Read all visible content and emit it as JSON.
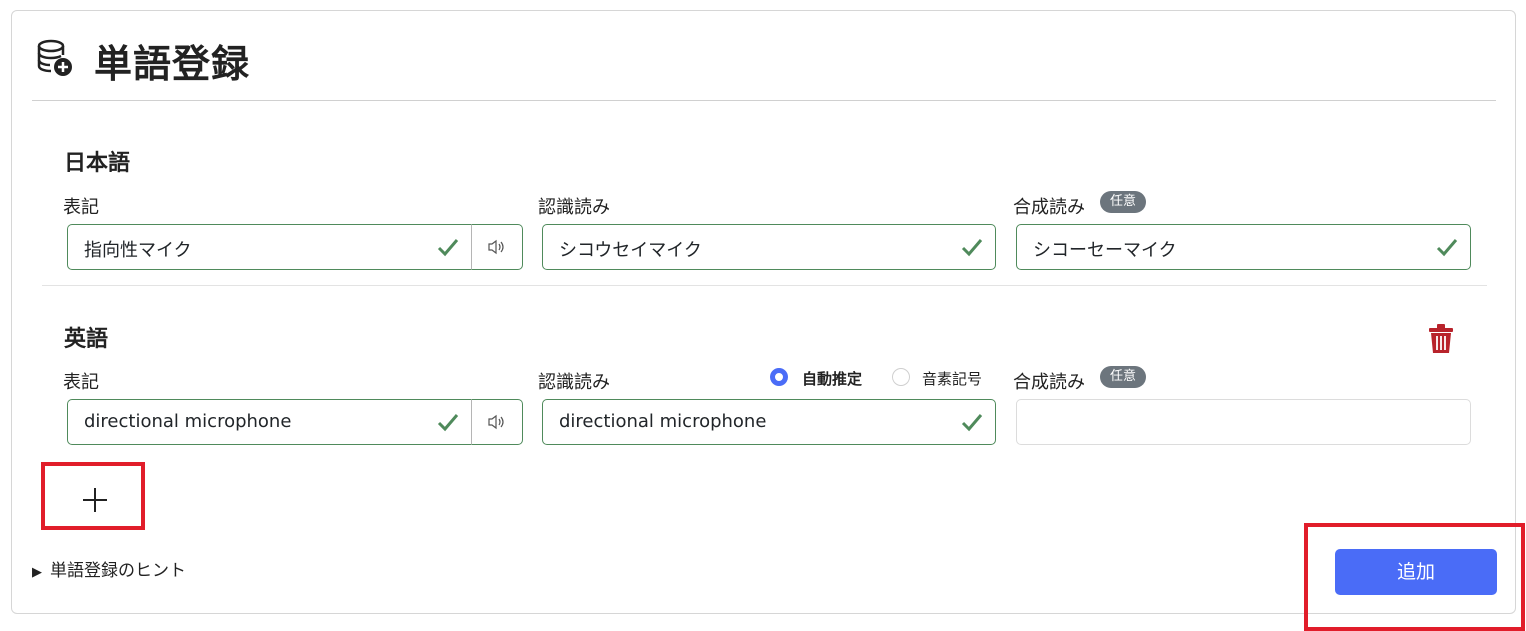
{
  "header": {
    "title": "単語登録",
    "icon": "database-add-icon"
  },
  "japanese": {
    "section_title": "日本語",
    "notation_label": "表記",
    "notation_value": "指向性マイク",
    "recognition_label": "認識読み",
    "recognition_value": "シコウセイマイク",
    "synthesis_label": "合成読み",
    "synthesis_badge": "任意",
    "synthesis_value": "シコーセーマイク"
  },
  "english": {
    "section_title": "英語",
    "notation_label": "表記",
    "notation_value": "directional microphone",
    "recognition_label": "認識読み",
    "recognition_value": "directional microphone",
    "radio_auto": "自動推定",
    "radio_phoneme": "音素記号",
    "radio_selected": "自動推定",
    "synthesis_label": "合成読み",
    "synthesis_badge": "任意",
    "synthesis_value": ""
  },
  "hint": {
    "label": "単語登録のヒント"
  },
  "actions": {
    "submit_label": "追加",
    "add_language": "+"
  },
  "colors": {
    "accent": "#4a6cf7",
    "valid": "#4f8a5b",
    "danger": "#b8232b",
    "highlight": "#e11d2a"
  }
}
